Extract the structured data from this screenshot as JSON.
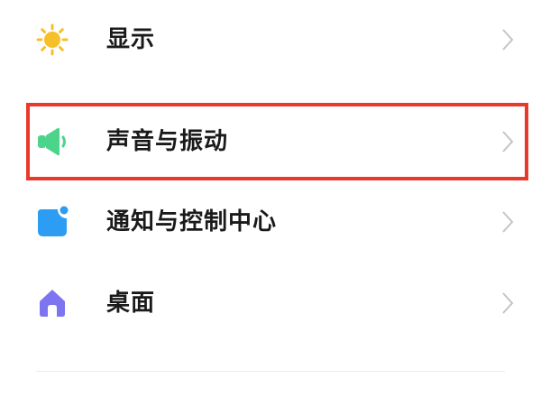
{
  "settings": {
    "items": [
      {
        "label": "显示",
        "icon": "sun-icon"
      },
      {
        "label": "声音与振动",
        "icon": "speaker-icon"
      },
      {
        "label": "通知与控制中心",
        "icon": "notification-icon"
      },
      {
        "label": "桌面",
        "icon": "home-icon"
      }
    ]
  },
  "colors": {
    "sun": "#f5c02a",
    "speaker": "#4cd48a",
    "notification": "#2c9df2",
    "home": "#7d74f0",
    "highlight": "#e8392a",
    "chevron": "#c4c4c4",
    "text": "#1a1a1a"
  }
}
